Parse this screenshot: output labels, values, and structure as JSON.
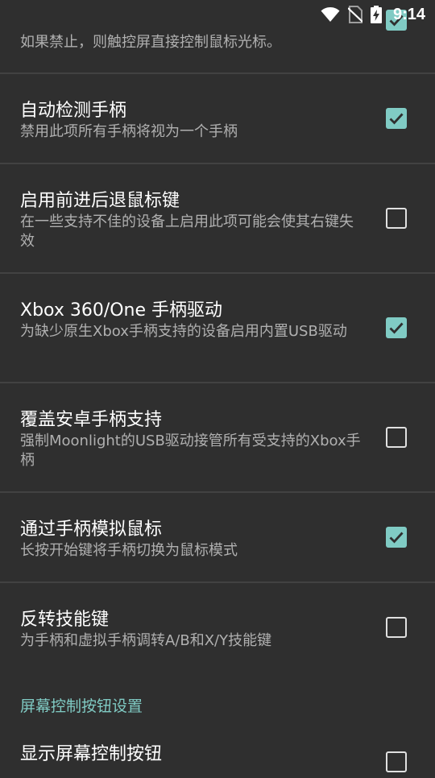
{
  "status_bar": {
    "time": "9:14",
    "icons": [
      "wifi-icon",
      "no-sim-icon",
      "battery-charging-icon"
    ]
  },
  "colors": {
    "background": "#2f2f2f",
    "divider": "#424242",
    "accent": "#80cbc4",
    "summary_text": "#b0b0b0"
  },
  "prefs": [
    {
      "summary": "如果禁止，则触控屏直接控制鼠标光标。",
      "checked": true
    },
    {
      "title": "自动检测手柄",
      "summary": "禁用此项所有手柄将视为一个手柄",
      "checked": true
    },
    {
      "title": "启用前进后退鼠标键",
      "summary": "在一些支持不佳的设备上启用此项可能会使其右键失效",
      "checked": false
    },
    {
      "title": "Xbox 360/One 手柄驱动",
      "summary": "为缺少原生Xbox手柄支持的设备启用内置USB驱动",
      "checked": true
    },
    {
      "title": "覆盖安卓手柄支持",
      "summary": "强制Moonlight的USB驱动接管所有受支持的Xbox手柄",
      "checked": false
    },
    {
      "title": "通过手柄模拟鼠标",
      "summary": "长按开始键将手柄切换为鼠标模式",
      "checked": true
    },
    {
      "title": "反转技能键",
      "summary": "为手柄和虚拟手柄调转A/B和X/Y技能键",
      "checked": false
    }
  ],
  "section": {
    "title": "屏幕控制按钮设置"
  },
  "section_prefs": [
    {
      "title": "显示屏幕控制按钮",
      "checked": false
    }
  ]
}
